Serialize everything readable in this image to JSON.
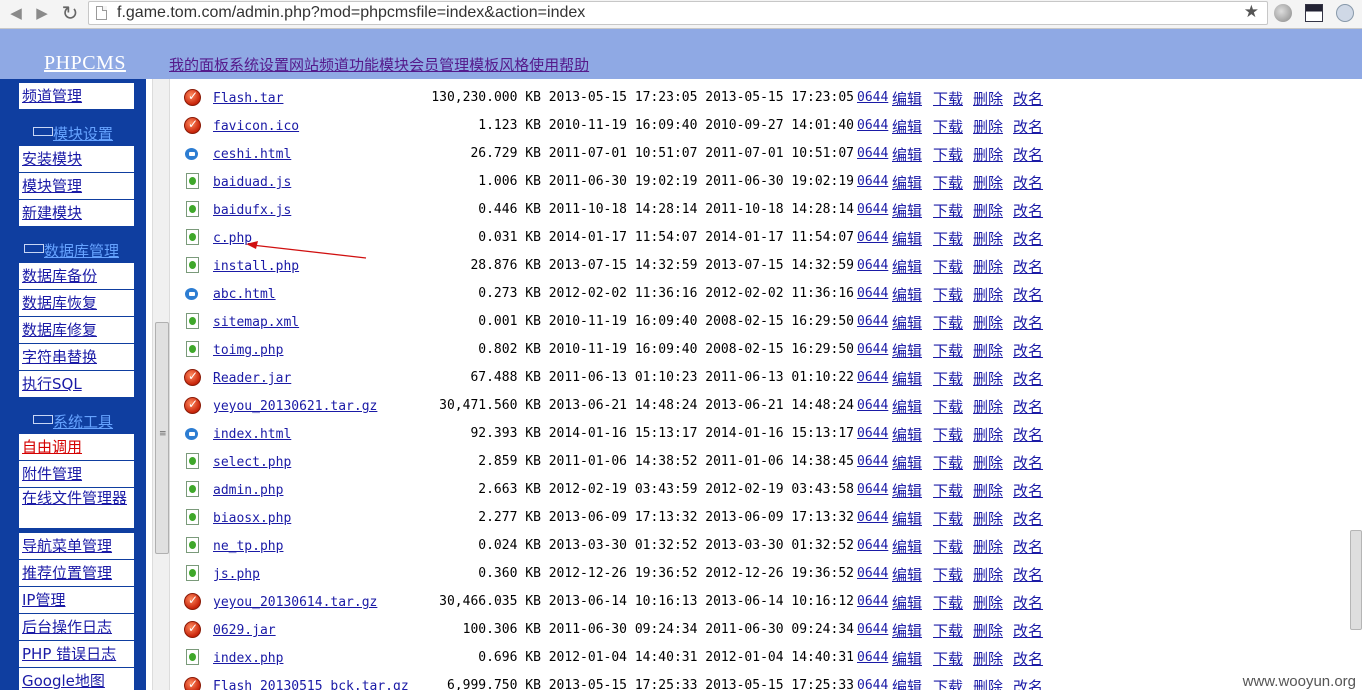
{
  "browser": {
    "url": "f.game.tom.com/admin.php?mod=phpcmsfile=index&action=index",
    "back_icon": "back-arrow",
    "forward_icon": "forward-arrow",
    "reload_icon": "reload"
  },
  "header": {
    "logo": "PHPCMS",
    "menu": [
      "我的面板",
      "系统设置",
      "网站频道",
      "功能模块",
      "会员管理",
      "模板风格",
      "使用帮助"
    ]
  },
  "sidebar": {
    "top_item": "频道管理",
    "groups": [
      {
        "title": "模块设置",
        "items": [
          "安装模块",
          "模块管理",
          "新建模块"
        ]
      },
      {
        "title": "数据库管理",
        "items": [
          "数据库备份",
          "数据库恢复",
          "数据库修复",
          "字符串替换",
          "执行SQL"
        ]
      },
      {
        "title": "系统工具",
        "items": [
          "自由调用",
          "附件管理",
          "在线文件管理器",
          "导航菜单管理",
          "推荐位置管理",
          "IP管理",
          "后台操作日志",
          "PHP 错误日志",
          "Google地图"
        ]
      }
    ]
  },
  "actions": {
    "edit": "编辑",
    "download": "下载",
    "delete": "删除",
    "rename": "改名"
  },
  "files": [
    {
      "name": "Flash.tar",
      "icon": "error-icon",
      "size": "130,230.000 KB",
      "created": "2013-05-15 17:23:05",
      "modified": "2013-05-15 17:23:05",
      "perm": "0644"
    },
    {
      "name": "favicon.ico",
      "icon": "error-icon",
      "size": "1.123 KB",
      "created": "2010-11-19 16:09:40",
      "modified": "2010-09-27 14:01:40",
      "perm": "0644"
    },
    {
      "name": "ceshi.html",
      "icon": "ie-icon",
      "size": "26.729 KB",
      "created": "2011-07-01 10:51:07",
      "modified": "2011-07-01 10:51:07",
      "perm": "0644"
    },
    {
      "name": "baiduad.js",
      "icon": "doc-icon",
      "size": "1.006 KB",
      "created": "2011-06-30 19:02:19",
      "modified": "2011-06-30 19:02:19",
      "perm": "0644"
    },
    {
      "name": "baidufx.js",
      "icon": "doc-icon",
      "size": "0.446 KB",
      "created": "2011-10-18 14:28:14",
      "modified": "2011-10-18 14:28:14",
      "perm": "0644"
    },
    {
      "name": "c.php",
      "icon": "doc-icon",
      "size": "0.031 KB",
      "created": "2014-01-17 11:54:07",
      "modified": "2014-01-17 11:54:07",
      "perm": "0644"
    },
    {
      "name": "install.php",
      "icon": "doc-icon",
      "size": "28.876 KB",
      "created": "2013-07-15 14:32:59",
      "modified": "2013-07-15 14:32:59",
      "perm": "0644"
    },
    {
      "name": "abc.html",
      "icon": "ie-icon",
      "size": "0.273 KB",
      "created": "2012-02-02 11:36:16",
      "modified": "2012-02-02 11:36:16",
      "perm": "0644"
    },
    {
      "name": "sitemap.xml",
      "icon": "doc-icon",
      "size": "0.001 KB",
      "created": "2010-11-19 16:09:40",
      "modified": "2008-02-15 16:29:50",
      "perm": "0644"
    },
    {
      "name": "toimg.php",
      "icon": "doc-icon",
      "size": "0.802 KB",
      "created": "2010-11-19 16:09:40",
      "modified": "2008-02-15 16:29:50",
      "perm": "0644"
    },
    {
      "name": "Reader.jar",
      "icon": "error-icon",
      "size": "67.488 KB",
      "created": "2011-06-13 01:10:23",
      "modified": "2011-06-13 01:10:22",
      "perm": "0644"
    },
    {
      "name": "yeyou_20130621.tar.gz",
      "icon": "error-icon",
      "size": "30,471.560 KB",
      "created": "2013-06-21 14:48:24",
      "modified": "2013-06-21 14:48:24",
      "perm": "0644"
    },
    {
      "name": "index.html",
      "icon": "ie-icon",
      "size": "92.393 KB",
      "created": "2014-01-16 15:13:17",
      "modified": "2014-01-16 15:13:17",
      "perm": "0644"
    },
    {
      "name": "select.php",
      "icon": "doc-icon",
      "size": "2.859 KB",
      "created": "2011-01-06 14:38:52",
      "modified": "2011-01-06 14:38:45",
      "perm": "0644"
    },
    {
      "name": "admin.php",
      "icon": "doc-icon",
      "size": "2.663 KB",
      "created": "2012-02-19 03:43:59",
      "modified": "2012-02-19 03:43:58",
      "perm": "0644"
    },
    {
      "name": "biaosx.php",
      "icon": "doc-icon",
      "size": "2.277 KB",
      "created": "2013-06-09 17:13:32",
      "modified": "2013-06-09 17:13:32",
      "perm": "0644"
    },
    {
      "name": "ne_tp.php",
      "icon": "doc-icon",
      "size": "0.024 KB",
      "created": "2013-03-30 01:32:52",
      "modified": "2013-03-30 01:32:52",
      "perm": "0644"
    },
    {
      "name": "js.php",
      "icon": "doc-icon",
      "size": "0.360 KB",
      "created": "2012-12-26 19:36:52",
      "modified": "2012-12-26 19:36:52",
      "perm": "0644"
    },
    {
      "name": "yeyou_20130614.tar.gz",
      "icon": "error-icon",
      "size": "30,466.035 KB",
      "created": "2013-06-14 10:16:13",
      "modified": "2013-06-14 10:16:12",
      "perm": "0644"
    },
    {
      "name": "0629.jar",
      "icon": "error-icon",
      "size": "100.306 KB",
      "created": "2011-06-30 09:24:34",
      "modified": "2011-06-30 09:24:34",
      "perm": "0644"
    },
    {
      "name": "index.php",
      "icon": "doc-icon",
      "size": "0.696 KB",
      "created": "2012-01-04 14:40:31",
      "modified": "2012-01-04 14:40:31",
      "perm": "0644"
    },
    {
      "name": "Flash_20130515_bck.tar.gz",
      "icon": "error-icon",
      "size": "6,999.750 KB",
      "created": "2013-05-15 17:25:33",
      "modified": "2013-05-15 17:25:33",
      "perm": "0644"
    }
  ],
  "watermark": "www.wooyun.org"
}
